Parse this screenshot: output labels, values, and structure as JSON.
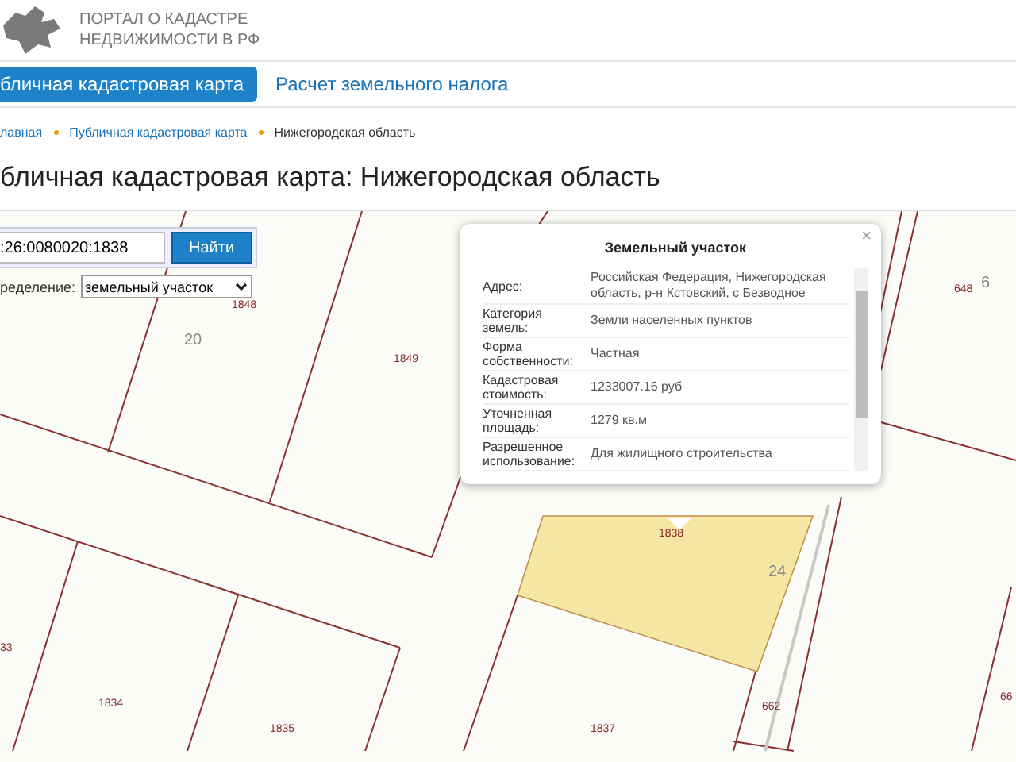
{
  "header": {
    "title_lines": [
      "ПОРТАЛ О КАДАСТРЕ",
      "НЕДВИЖИМОСТИ В РФ"
    ]
  },
  "nav_tabs": [
    {
      "label": "бличная кадастровая карта",
      "selected": true
    },
    {
      "label": "Расчет земельного налога",
      "selected": false
    }
  ],
  "breadcrumbs": [
    "лавная",
    "Публичная кадастровая карта",
    "Нижегородская область"
  ],
  "page_title": "бличная кадастровая карта: Нижегородская область",
  "map": {
    "search": {
      "value": ":26:0080020:1838",
      "button": "Найти"
    },
    "filter": {
      "label": "ределение:",
      "value": "земельный участок"
    },
    "parcel_labels": [
      {
        "text": "1848",
        "kind": "number"
      },
      {
        "text": "20",
        "kind": "block"
      },
      {
        "text": "1849",
        "kind": "number"
      },
      {
        "text": "1838",
        "kind": "number"
      },
      {
        "text": "24",
        "kind": "block"
      },
      {
        "text": "648",
        "kind": "number"
      },
      {
        "text": "6",
        "kind": "block"
      },
      {
        "text": "33",
        "kind": "number"
      },
      {
        "text": "1834",
        "kind": "number"
      },
      {
        "text": "1835",
        "kind": "number"
      },
      {
        "text": "1837",
        "kind": "number"
      },
      {
        "text": "662",
        "kind": "number"
      },
      {
        "text": "66",
        "kind": "number"
      }
    ],
    "popup": {
      "title": "Земельный участок",
      "close": "×",
      "rows": [
        {
          "label": "Адрес:",
          "value": "Российская Федерация, Нижегородская область, р-н Кстовский, с Безводное"
        },
        {
          "label": "Категория земель:",
          "value": "Земли населенных пунктов"
        },
        {
          "label": "Форма собственности:",
          "value": "Частная"
        },
        {
          "label": "Кадастровая стоимость:",
          "value": "1233007.16 руб"
        },
        {
          "label": "Уточненная площадь:",
          "value": "1279 кв.м"
        },
        {
          "label": "Разрешенное использование:",
          "value": "Для жилищного строительства"
        }
      ]
    }
  }
}
